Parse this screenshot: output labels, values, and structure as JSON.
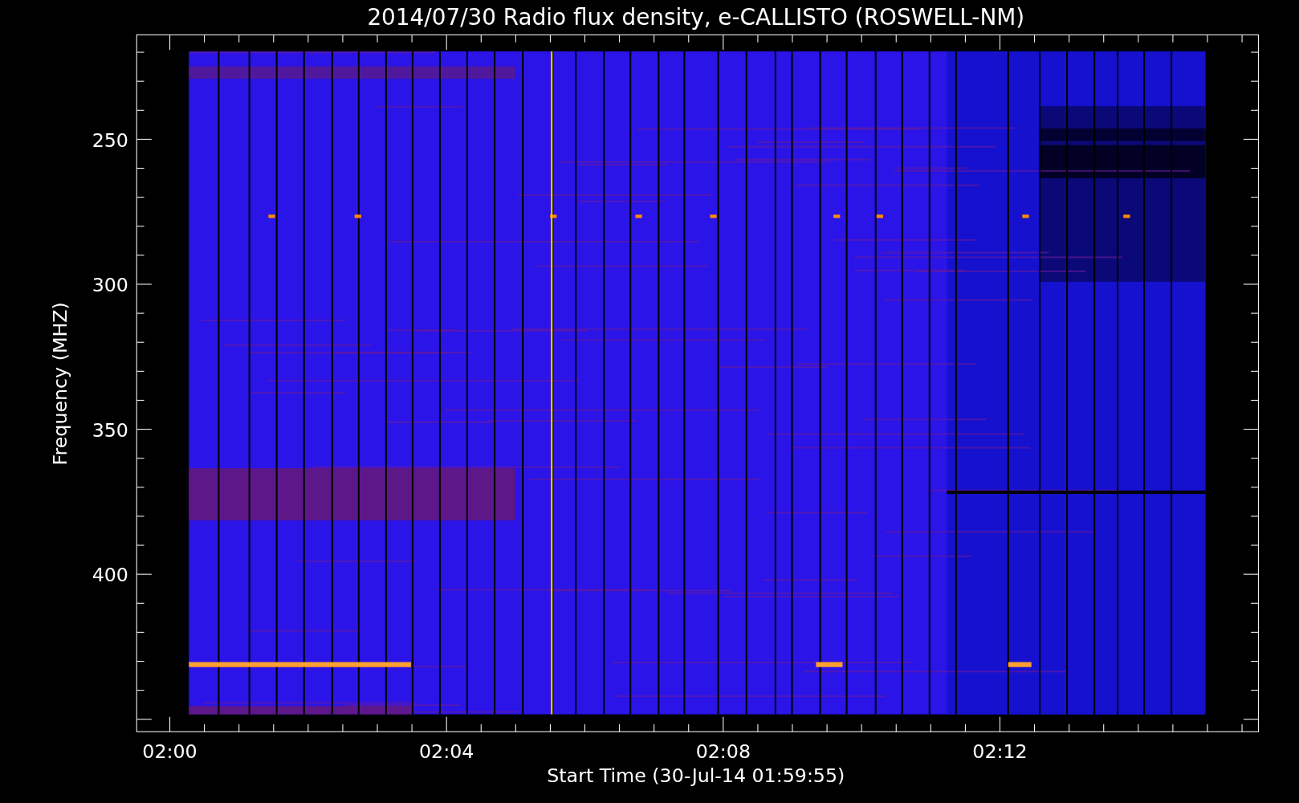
{
  "plot": {
    "title": "2014/07/30  Radio flux density, e-CALLISTO (ROSWELL-NM)",
    "xlabel": "Start Time (30-Jul-14 01:59:55)",
    "ylabel": "Frequency (MHZ)",
    "xticks": [
      "02:00",
      "02:04",
      "02:08",
      "02:12"
    ],
    "yticks": [
      "250",
      "300",
      "350",
      "400"
    ]
  }
}
